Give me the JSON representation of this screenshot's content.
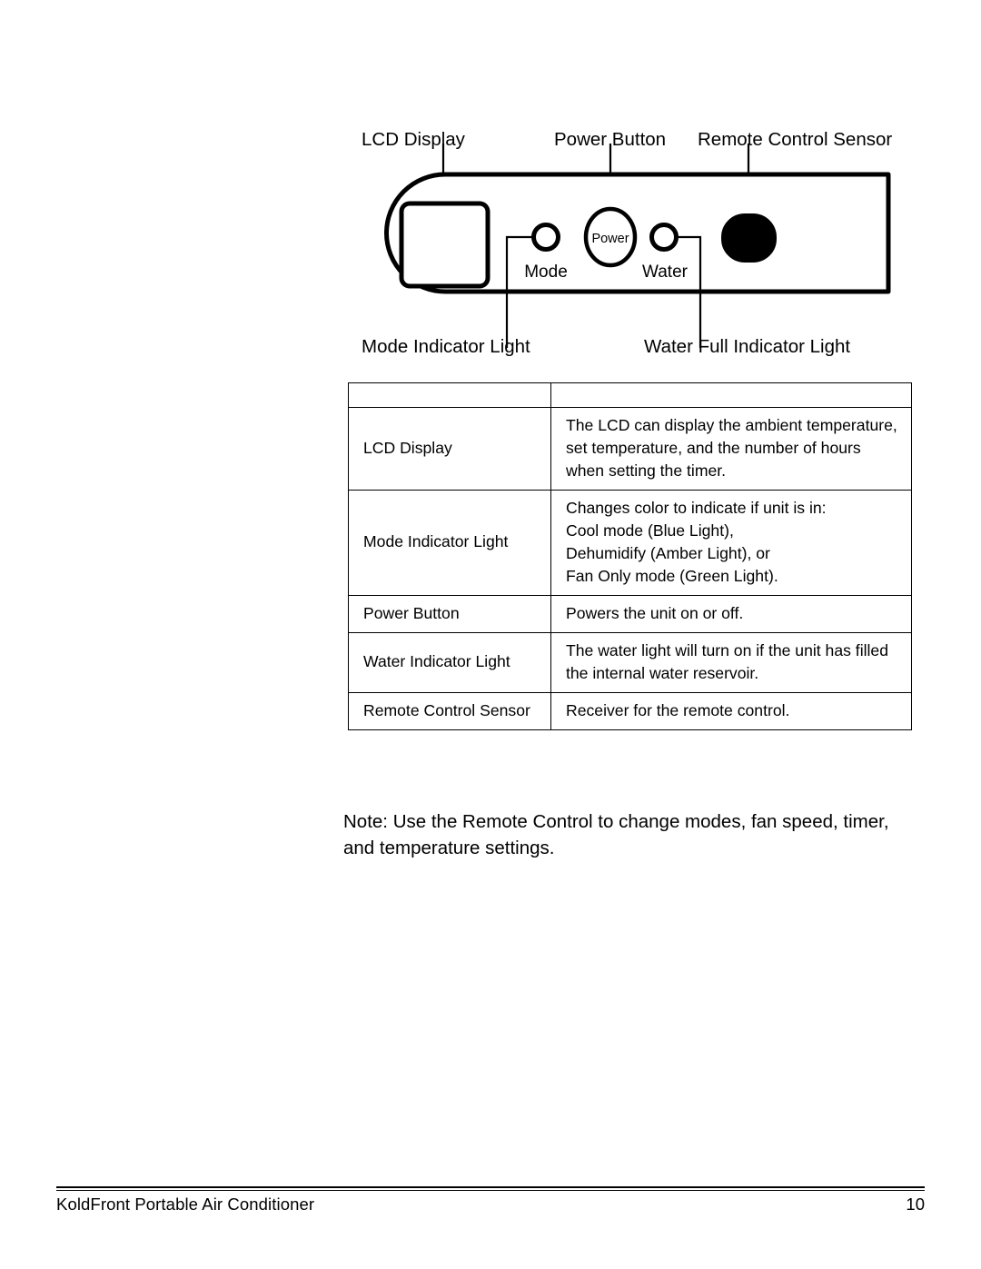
{
  "diagram": {
    "title": "portable air conditioner control panel",
    "callouts": [
      {
        "id": "lcd",
        "label": "LCD Display"
      },
      {
        "id": "power",
        "label": "Power Button"
      },
      {
        "id": "remote",
        "label": "Remote Control Sensor"
      },
      {
        "id": "mode_ind",
        "label": "Mode Indicator Light"
      },
      {
        "id": "water_ind",
        "label": "Water Full Indicator Light"
      }
    ],
    "panel_labels": {
      "power_button_text": "Power",
      "mode_light_text": "Mode",
      "water_light_text": "Water"
    },
    "colors": {
      "outline": "#000000",
      "remote_sensor_fill": "#000000",
      "panel_fill": "#ffffff"
    }
  },
  "table": {
    "header": {
      "col1": "",
      "col2": ""
    },
    "rows": [
      {
        "part": "LCD Display",
        "description": "The LCD can display the ambient temperature, set temperature, and the number of hours when setting the timer."
      },
      {
        "part": "Mode Indicator Light",
        "description": "Changes color to indicate if unit is in:\nCool mode (Blue Light),\nDehumidify (Amber Light), or\nFan Only mode (Green Light)."
      },
      {
        "part": "Power Button",
        "description": "Powers the unit on or off."
      },
      {
        "part": "Water Indicator Light",
        "description": "The water light will turn on if the unit has filled the internal water reservoir."
      },
      {
        "part": "Remote Control Sensor",
        "description": "Receiver for the remote control."
      }
    ]
  },
  "note": {
    "text": "Note: Use the Remote Control to change modes, fan speed, timer, and temperature settings."
  },
  "footer": {
    "document_title": "KoldFront Portable Air Conditioner",
    "page_number": "10"
  }
}
